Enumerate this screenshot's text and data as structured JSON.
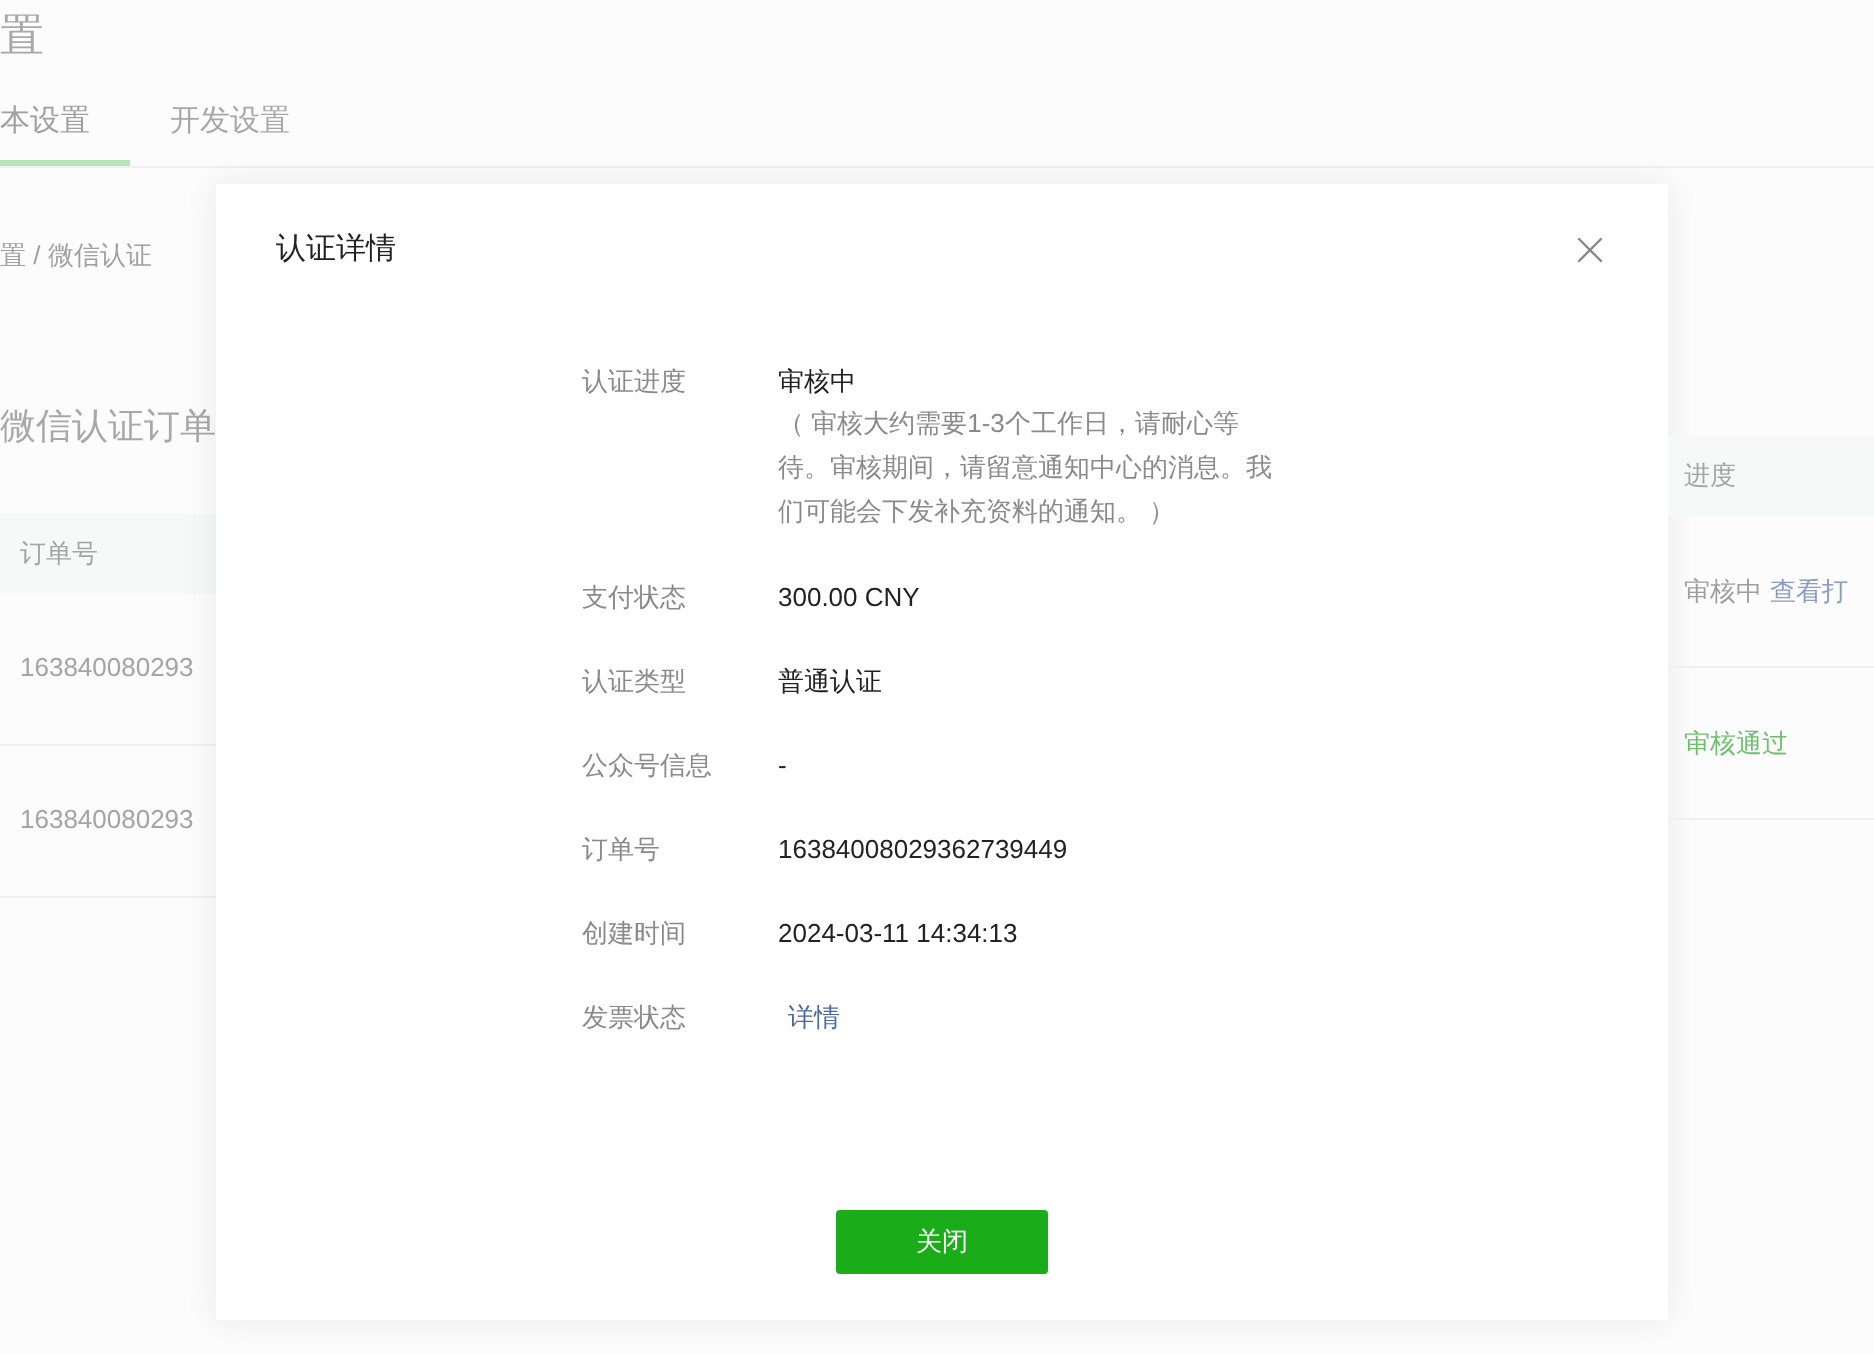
{
  "page": {
    "title": "置",
    "tabs": [
      {
        "label": "本设置",
        "selected": true
      },
      {
        "label": "开发设置",
        "selected": false
      }
    ],
    "breadcrumb": "置 / 微信认证",
    "section_title": "微信认证订单",
    "table": {
      "columns": [
        "订单号",
        "进度"
      ],
      "rows": [
        {
          "order_no": "163840080293",
          "progress": "审核中",
          "link": "查看打",
          "color": "#9e9e9e"
        },
        {
          "order_no": "163840080293",
          "progress": "审核通过",
          "color": "#6fbf6f"
        }
      ]
    }
  },
  "dialog": {
    "title": "认证详情",
    "fields": [
      {
        "label": "认证进度",
        "kind": "status",
        "value": "审核中",
        "note": "（ 审核大约需要1-3个工作日，请耐心等待。审核期间，请留意通知中心的消息。我们可能会下发补充资料的通知。 ）"
      },
      {
        "label": "支付状态",
        "kind": "text",
        "value": "300.00 CNY"
      },
      {
        "label": "认证类型",
        "kind": "text",
        "value": "普通认证"
      },
      {
        "label": "公众号信息",
        "kind": "text",
        "value": "-"
      },
      {
        "label": "订单号",
        "kind": "text",
        "value": "16384008029362739449"
      },
      {
        "label": "创建时间",
        "kind": "text",
        "value": "2024-03-11 14:34:13"
      },
      {
        "label": "发票状态",
        "kind": "link",
        "value": "详情"
      }
    ],
    "button": "关闭"
  }
}
